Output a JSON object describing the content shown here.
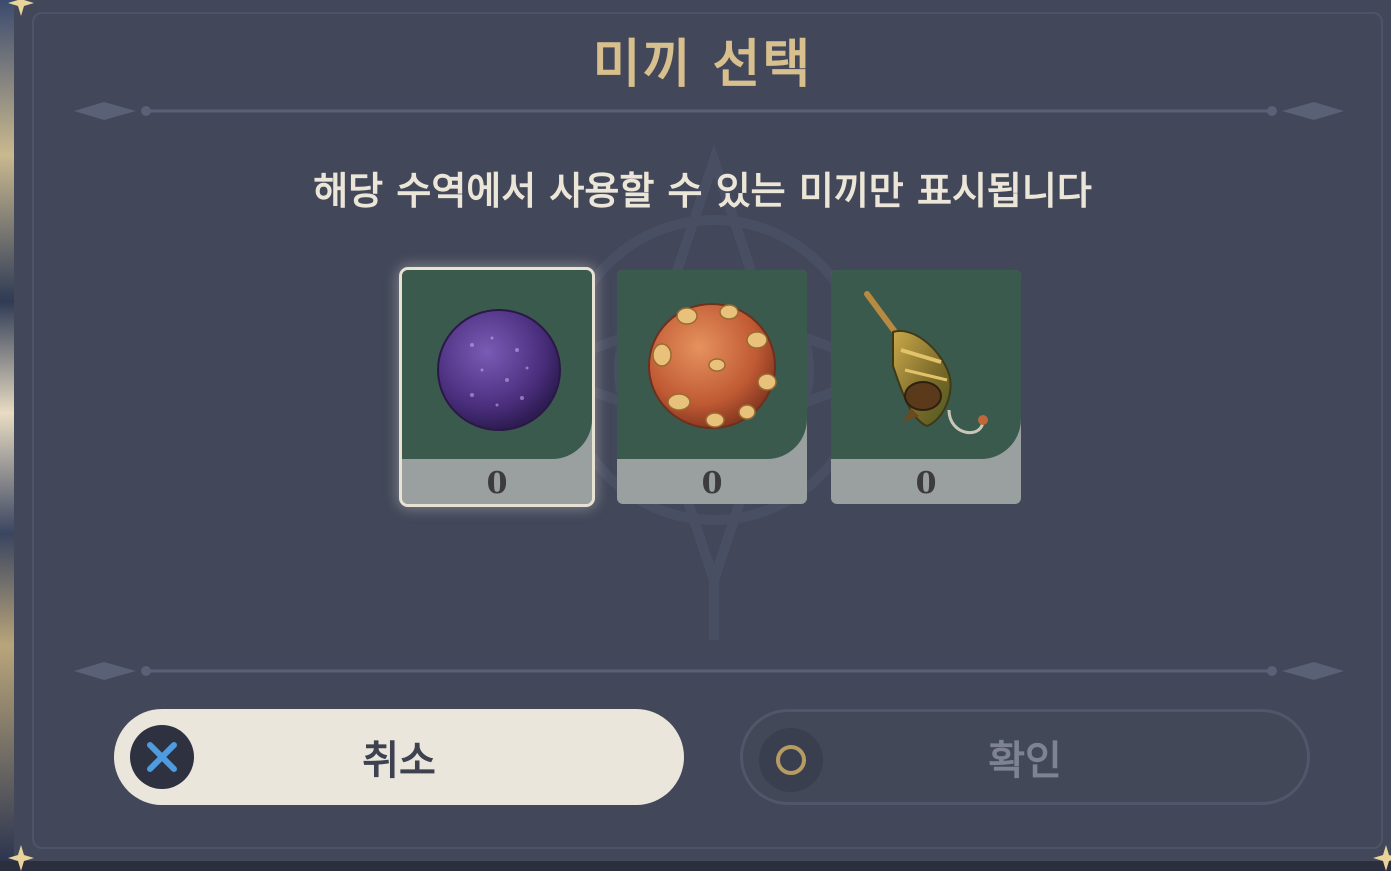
{
  "dialog": {
    "title": "미끼 선택",
    "subtitle": "해당 수역에서 사용할 수 있는 미끼만 표시됩니다"
  },
  "bait_slots": [
    {
      "icon": "purple-bait-ball-icon",
      "count": "0",
      "selected": true
    },
    {
      "icon": "orange-bait-ball-icon",
      "count": "0",
      "selected": false
    },
    {
      "icon": "fishing-lure-icon",
      "count": "0",
      "selected": false
    }
  ],
  "buttons": {
    "cancel_label": "취소",
    "cancel_icon": "close-x-icon",
    "confirm_label": "확인",
    "confirm_icon": "circle-confirm-icon"
  },
  "colors": {
    "title": "#d8c08e",
    "panel": "#424759",
    "slot_art_bg": "#3b5a4e",
    "cancel_button_bg": "#ebe6dc",
    "cancel_x": "#4f9be0",
    "confirm_circle": "#b69c63"
  }
}
